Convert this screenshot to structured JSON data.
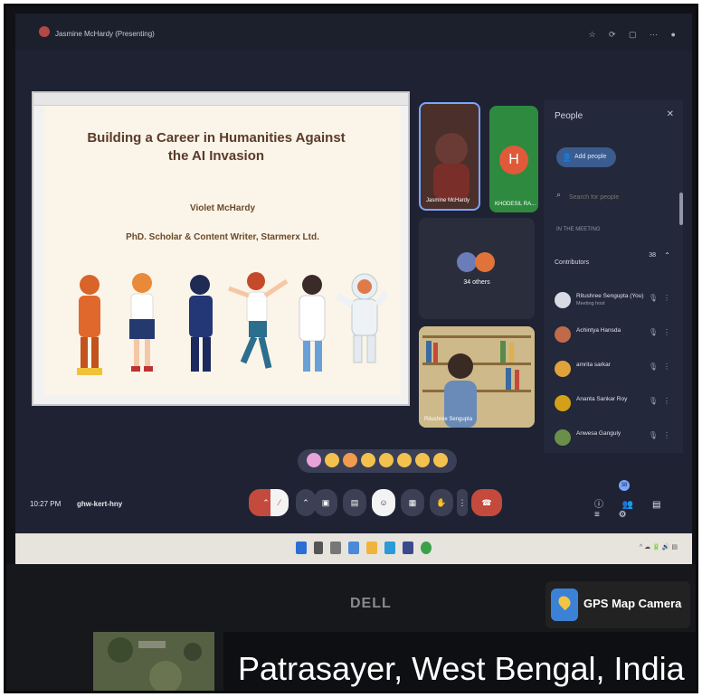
{
  "topbar": {
    "presenting_text": "Jasmine McHardy (Presenting)"
  },
  "slide": {
    "title": "Building a Career in Humanities Against the AI Invasion",
    "author": "Violet McHardy",
    "role": "PhD. Scholar & Content Writer, Starmerx Ltd."
  },
  "tiles": {
    "presenter_name": "Jasmine McHardy",
    "h_initial": "H",
    "h_name": "KHODESIL RA...",
    "others_label": "34 others",
    "cam_name": "Ritushree Sengupta"
  },
  "people_panel": {
    "title": "People",
    "add_people": "Add people",
    "search_placeholder": "Search for people",
    "in_meeting_label": "IN THE MEETING",
    "contributors_label": "Contributors",
    "contributors_count": "38",
    "people": [
      {
        "name": "Ritushree Sengupta (You)",
        "sub": "Meeting host",
        "color": "#d9dbe4"
      },
      {
        "name": "Achintya Hansda",
        "sub": "",
        "color": "#c06a4a"
      },
      {
        "name": "amrita sarkar",
        "sub": "",
        "color": "#e0a23a"
      },
      {
        "name": "Ananta Sankar Roy",
        "sub": "",
        "color": "#d4a017"
      },
      {
        "name": "Anwesa Ganguly",
        "sub": "",
        "color": "#6a8f4a"
      }
    ]
  },
  "controls": {
    "clock": "10:27 PM",
    "meeting_code": "ghw-kert-hny",
    "participants_badge": "38"
  },
  "overlay": {
    "brand": "DELL",
    "app_label": "GPS Map Camera",
    "location": "Patrasayer, West Bengal, India"
  },
  "colors": {
    "screen_bg": "#1e2233",
    "accent_red": "#c44a3e",
    "accent_blue": "#7aa6ff",
    "slide_bg": "#fbf4e8"
  }
}
